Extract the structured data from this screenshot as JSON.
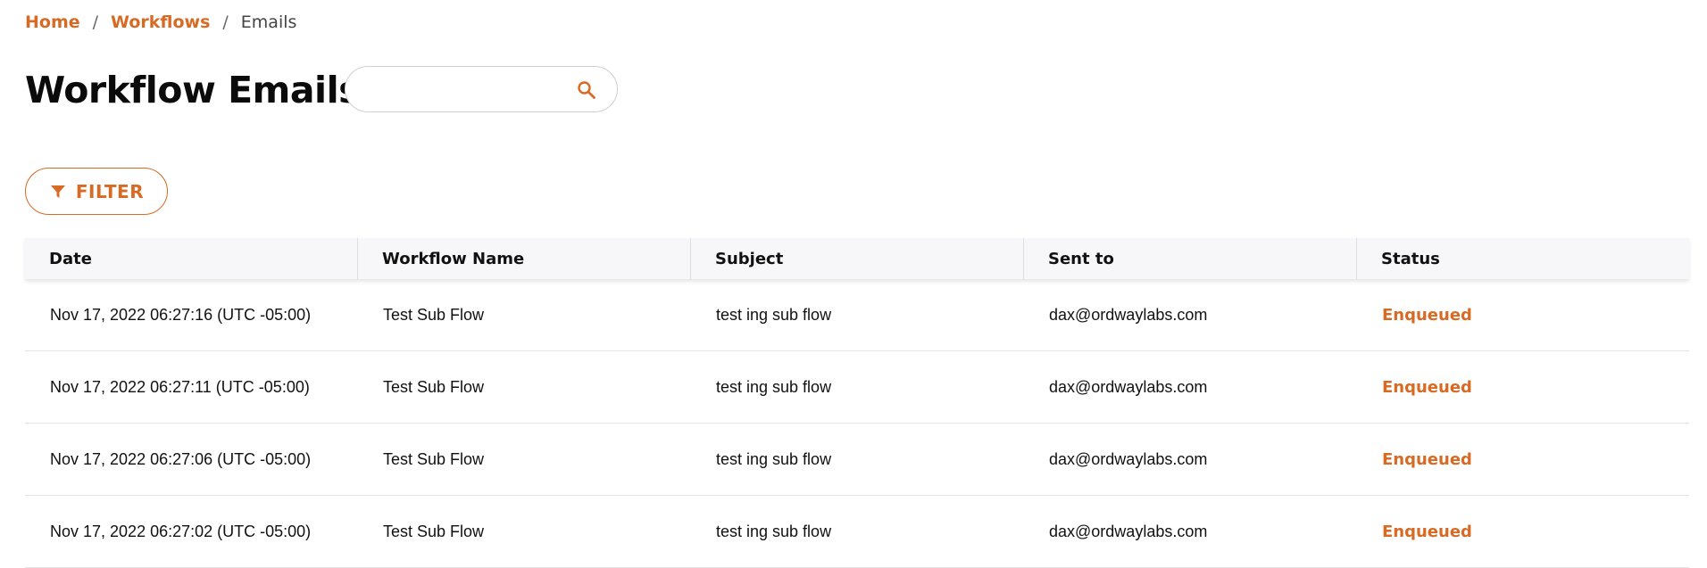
{
  "breadcrumb": {
    "home": "Home",
    "workflows": "Workflows",
    "current": "Emails",
    "separator": "/"
  },
  "page": {
    "title": "Workflow Emails"
  },
  "search": {
    "value": "",
    "placeholder": "",
    "icon": "search-icon"
  },
  "filter": {
    "label": "FILTER",
    "icon": "filter-icon"
  },
  "colors": {
    "accent": "#d86a24",
    "header_bg": "#f7f7f9"
  },
  "table": {
    "columns": [
      "Date",
      "Workflow Name",
      "Subject",
      "Sent to",
      "Status"
    ],
    "rows": [
      [
        "Nov 17, 2022 06:27:16 (UTC -05:00)",
        "Test Sub Flow",
        "test ing sub flow",
        "dax@ordwaylabs.com",
        "Enqueued"
      ],
      [
        "Nov 17, 2022 06:27:11 (UTC -05:00)",
        "Test Sub Flow",
        "test ing sub flow",
        "dax@ordwaylabs.com",
        "Enqueued"
      ],
      [
        "Nov 17, 2022 06:27:06 (UTC -05:00)",
        "Test Sub Flow",
        "test ing sub flow",
        "dax@ordwaylabs.com",
        "Enqueued"
      ],
      [
        "Nov 17, 2022 06:27:02 (UTC -05:00)",
        "Test Sub Flow",
        "test ing sub flow",
        "dax@ordwaylabs.com",
        "Enqueued"
      ]
    ]
  }
}
